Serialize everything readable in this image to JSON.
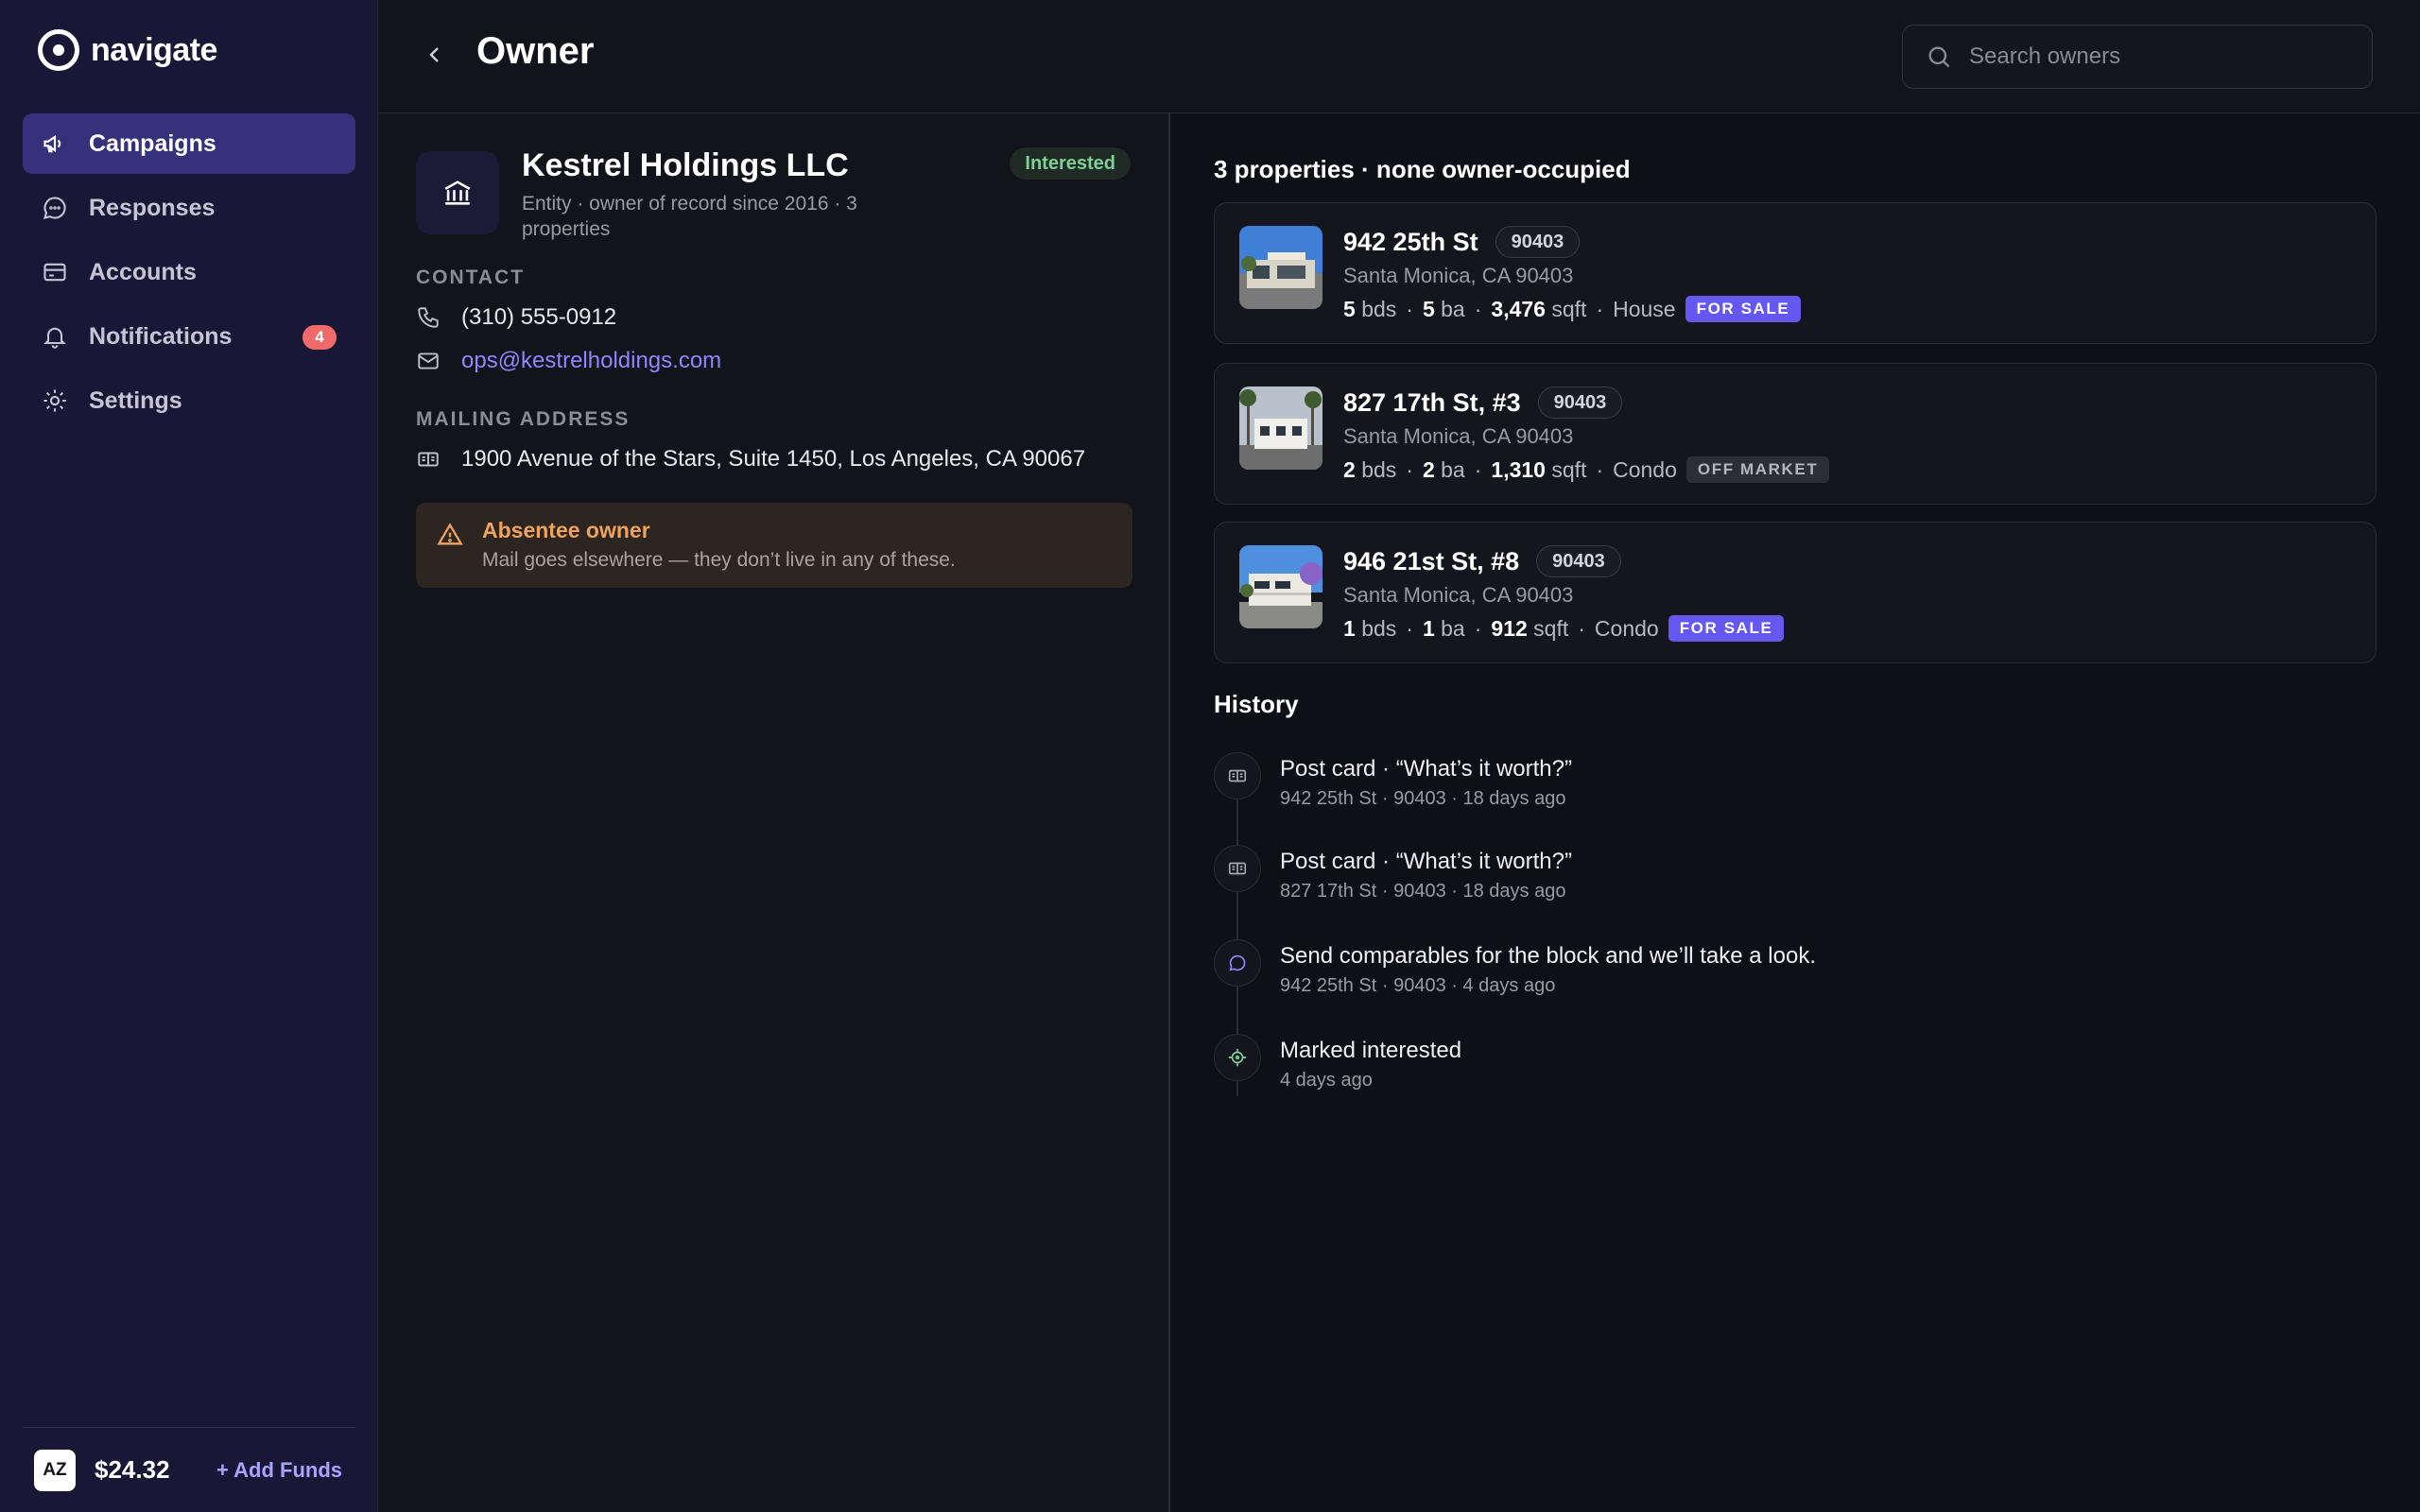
{
  "brand": {
    "name": "navigate"
  },
  "sidebar": {
    "items": [
      {
        "label": "Campaigns",
        "icon": "megaphone-icon",
        "active": true
      },
      {
        "label": "Responses",
        "icon": "chat-bubble-icon"
      },
      {
        "label": "Accounts",
        "icon": "credit-card-icon"
      },
      {
        "label": "Notifications",
        "icon": "bell-icon",
        "badge": "4"
      },
      {
        "label": "Settings",
        "icon": "gear-icon"
      }
    ],
    "footer": {
      "avatar": "AZ",
      "balance": "$24.32",
      "add_funds": "+ Add Funds"
    }
  },
  "header": {
    "title": "Owner",
    "search_placeholder": "Search owners"
  },
  "owner": {
    "name": "Kestrel Holdings LLC",
    "meta": "Entity · owner of record since 2016 · 3 properties",
    "status": "Interested",
    "contact_label": "CONTACT",
    "phone": "(310) 555-0912",
    "email": "ops@kestrelholdings.com",
    "mailing_label": "MAILING ADDRESS",
    "mailing_address": "1900 Avenue of the Stars, Suite 1450, Los Angeles, CA 90067",
    "alert": {
      "title": "Absentee owner",
      "text": "Mail goes elsewhere — they don’t live in any of these."
    }
  },
  "properties": {
    "heading": "3 properties · none owner-occupied",
    "items": [
      {
        "address": "942 25th St",
        "zip": "90403",
        "city": "Santa Monica, CA 90403",
        "beds": "5",
        "baths": "5",
        "sqft": "3,476",
        "type": "House",
        "tag": "FOR SALE",
        "tag_kind": "sale"
      },
      {
        "address": "827 17th St, #3",
        "zip": "90403",
        "city": "Santa Monica, CA 90403",
        "beds": "2",
        "baths": "2",
        "sqft": "1,310",
        "type": "Condo",
        "tag": "OFF MARKET",
        "tag_kind": "off"
      },
      {
        "address": "946 21st St, #8",
        "zip": "90403",
        "city": "Santa Monica, CA 90403",
        "beds": "1",
        "baths": "1",
        "sqft": "912",
        "type": "Condo",
        "tag": "FOR SALE",
        "tag_kind": "sale"
      }
    ],
    "labels": {
      "bds": "bds",
      "ba": "ba",
      "sqft": "sqft"
    }
  },
  "history": {
    "heading": "History",
    "items": [
      {
        "title": "Post card · “What’s it worth?”",
        "sub": "942 25th St · 90403 · 18 days ago",
        "icon": "postcard-icon"
      },
      {
        "title": "Post card · “What’s it worth?”",
        "sub": "827 17th St · 90403 · 18 days ago",
        "icon": "postcard-icon"
      },
      {
        "title": "Send comparables for the block and we’ll take a look.",
        "sub": "942 25th St · 90403 · 4 days ago",
        "icon": "chat-bubble-icon"
      },
      {
        "title": "Marked interested",
        "sub": "4 days ago",
        "icon": "target-icon"
      }
    ]
  },
  "colors": {
    "accent": "#6458f0",
    "sidebar_bg": "#1a1635",
    "warning": "#f0a35c",
    "success": "#7fcf98"
  }
}
